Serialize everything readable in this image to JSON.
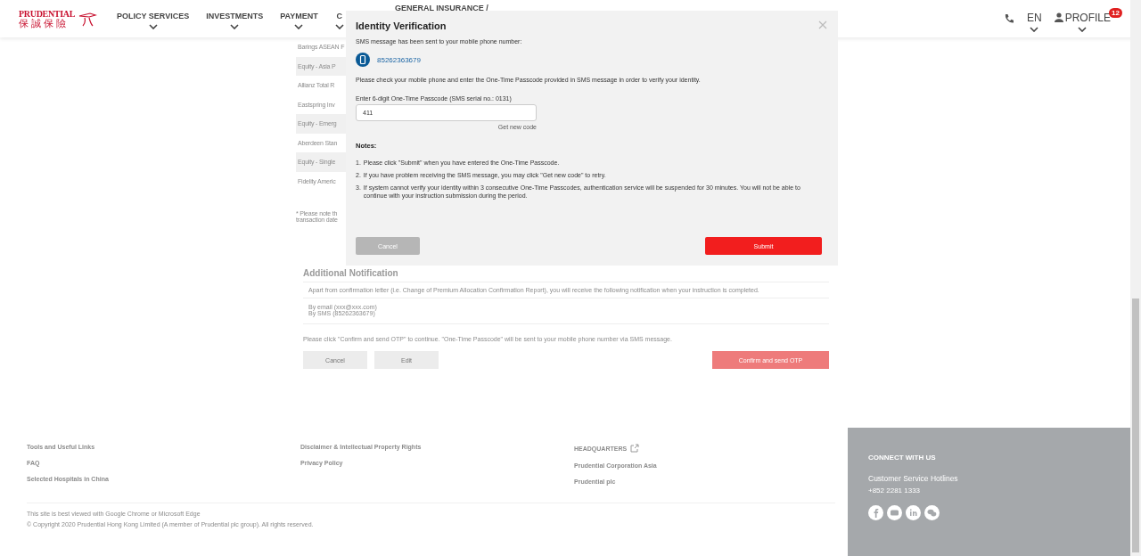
{
  "header": {
    "logo": {
      "name": "PRUDENTIAL",
      "chinese": "保 誠 保 險"
    },
    "nav": [
      {
        "label": "POLICY SERVICES"
      },
      {
        "label": "INVESTMENTS"
      },
      {
        "label": "PAYMENT"
      },
      {
        "label": "C"
      }
    ],
    "nav_partial": "GENERAL INSURANCE /",
    "language": "EN",
    "profile": {
      "label": "PROFILE",
      "badge": "12"
    }
  },
  "funds": [
    {
      "kind": "fund",
      "label": "Barings ASEAN F"
    },
    {
      "kind": "group",
      "label": "Equity - Asia P"
    },
    {
      "kind": "fund",
      "label": "Allianz Total R"
    },
    {
      "kind": "fund",
      "label": "Eastspring Inv"
    },
    {
      "kind": "group",
      "label": "Equity - Emerg"
    },
    {
      "kind": "fund",
      "label": "Aberdeen Stan"
    },
    {
      "kind": "group",
      "label": "Equity - Single"
    },
    {
      "kind": "fund",
      "label": "Fidelity Americ"
    }
  ],
  "fund_note": [
    "* Please note th",
    "transaction date"
  ],
  "additional_notification": {
    "title": "Additional Notification",
    "description": "Apart from confirmation letter (i.e. Change of Premium Allocation Confirmation Report), you will receive the following notification when your instruction is completed.",
    "channels": [
      "By email (xxx@xxx.com)",
      "By SMS (85262363679)"
    ],
    "instruction": "Please click \"Confirm and send OTP\" to continue. \"One-Time Passcode\" will be sent to your mobile phone number via SMS message.",
    "buttons": [
      {
        "kind": "secondary",
        "label": "Cancel"
      },
      {
        "kind": "secondary",
        "label": "Edit"
      },
      {
        "kind": "primary",
        "label": "Confirm and send OTP"
      }
    ]
  },
  "modal": {
    "title": "Identity Verification",
    "message": "SMS message has been sent to your mobile phone number:",
    "phone": "85262363679",
    "instruction": "Please check your mobile phone and enter the One-Time Passcode provided in SMS message in order to verify your identity.",
    "field_label": "Enter 6-digit One-Time Passcode (SMS serial no.: 0131)",
    "value": "411",
    "link": "Get new code",
    "notes_title": "Notes:",
    "notes": [
      {
        "number": "1.",
        "text": "Please click \"Submit\" when you have entered the One-Time Passcode."
      },
      {
        "number": "2.",
        "text": "If you have problem receiving the SMS message, you may click \"Get new code\" to retry."
      },
      {
        "number": "3.",
        "text": "If system cannot verify your identity within 3 consecutive One-Time Passcodes, authentication service will be suspended for 30 minutes. You will not be able to continue with your instruction submission during the period."
      }
    ],
    "buttons": [
      {
        "kind": "secondary",
        "label": "Cancel"
      },
      {
        "kind": "primary",
        "label": "Submit"
      }
    ]
  },
  "footer": {
    "columns": [
      [
        {
          "label": "Tools and Useful Links"
        },
        {
          "label": "FAQ"
        },
        {
          "label": "Selected Hospitals in China"
        }
      ],
      [
        {
          "label": "Disclaimer & Intellectual Property Rights"
        },
        {
          "label": "Privacy Policy"
        }
      ],
      [
        {
          "label": "HEADQUARTERS",
          "external": true
        },
        {
          "label": "Prudential Corporation Asia"
        },
        {
          "label": "Prudential plc"
        }
      ]
    ],
    "browser_note": "This site is best viewed with Google Chrome or Microsoft Edge",
    "copyright": "© Copyright 2020 Prudential Hong Kong Limited (A member of Prudential plc group). All rights reserved.",
    "connect": {
      "title": "CONNECT WITH US",
      "hotline_label": "Customer Service Hotlines",
      "hotline": "+852 2281 1333",
      "social": [
        {
          "kind": "facebook"
        },
        {
          "kind": "youtube"
        },
        {
          "kind": "linkedin"
        },
        {
          "kind": "wechat"
        }
      ]
    }
  }
}
